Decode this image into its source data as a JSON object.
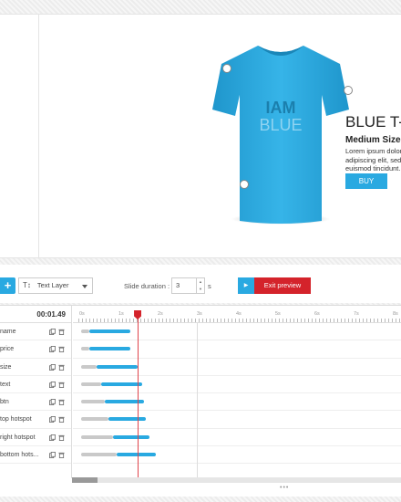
{
  "stage": {
    "tshirt_text_line1": "IAM",
    "tshirt_text_line2": "BLUE",
    "title": "BLUE T-S",
    "size": "Medium Size",
    "desc_lines": [
      "Lorem ipsum dolor",
      "adipiscing elit, sed d",
      "euismod tincidunt."
    ],
    "buy_label": "BUY",
    "colors": {
      "tshirt": "#29a9e1",
      "buy": "#29a9e1"
    }
  },
  "toolbar": {
    "add_label": "+",
    "layer_type_icon": "T↕",
    "layer_type": "Text Layer",
    "slide_duration_label": "Slide duration :",
    "slide_duration_value": "3",
    "slide_duration_unit": "s",
    "play_icon": "▶",
    "exit_preview_label": "Exit preview"
  },
  "timeline": {
    "time": "00:01.49",
    "ruler_ticks": [
      "0s",
      "1s",
      "2s",
      "3s",
      "4s",
      "5s",
      "6s",
      "7s",
      "8s"
    ],
    "playhead_seconds": 1.49,
    "layers": [
      {
        "name": "name",
        "delay": [
          0.05,
          0.25
        ],
        "anim": [
          0.25,
          1.3
        ]
      },
      {
        "name": "price",
        "delay": [
          0.05,
          0.25
        ],
        "anim": [
          0.25,
          1.3
        ]
      },
      {
        "name": "size",
        "delay": [
          0.05,
          0.45
        ],
        "anim": [
          0.45,
          1.5
        ]
      },
      {
        "name": "text",
        "delay": [
          0.05,
          0.55
        ],
        "anim": [
          0.55,
          1.6
        ]
      },
      {
        "name": "btn",
        "delay": [
          0.05,
          0.65
        ],
        "anim": [
          0.65,
          1.65
        ]
      },
      {
        "name": "top hotspot",
        "delay": [
          0.05,
          0.75
        ],
        "anim": [
          0.75,
          1.7
        ]
      },
      {
        "name": "right hotspot",
        "delay": [
          0.05,
          0.85
        ],
        "anim": [
          0.85,
          1.8
        ]
      },
      {
        "name": "bottom hots...",
        "delay": [
          0.05,
          0.95
        ],
        "anim": [
          0.95,
          1.95
        ]
      }
    ],
    "resize_dots": "•••"
  }
}
